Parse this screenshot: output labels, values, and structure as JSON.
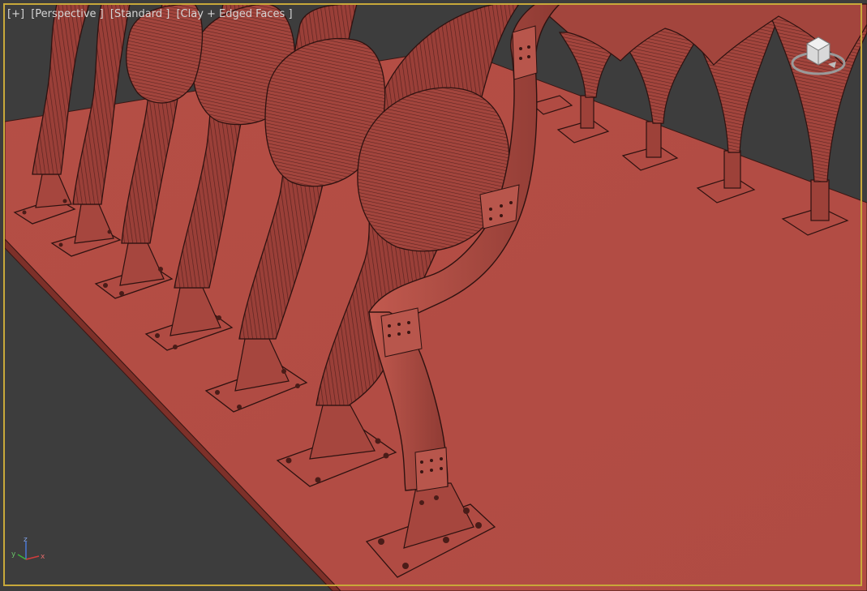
{
  "viewport": {
    "label_plus": "[+]",
    "label_view": "[Perspective ]",
    "label_shading_preset": "[Standard ]",
    "label_shading_mode": "[Clay + Edged Faces ]",
    "active_border_color": "#c8a83a"
  },
  "viewcube": {
    "icon": "viewcube-icon"
  },
  "axis_tripod": {
    "x_label": "x",
    "y_label": "y",
    "z_label": "z",
    "x_color": "#d23c3c",
    "y_color": "#3cb43c",
    "z_color": "#4a78d6"
  },
  "scene": {
    "object_color": "#b04b43",
    "background_color": "#3d3d3d"
  }
}
